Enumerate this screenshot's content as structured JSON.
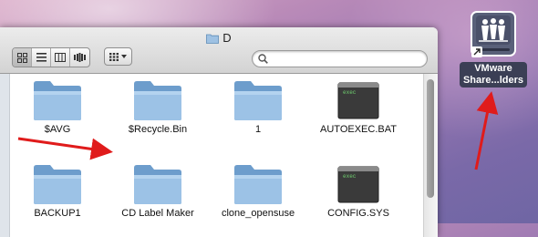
{
  "window": {
    "title": "D",
    "search": {
      "value": "",
      "placeholder": ""
    }
  },
  "toolbar": {
    "view_buttons": [
      "icon-view-icon",
      "list-view-icon",
      "column-view-icon",
      "cover-flow-icon"
    ],
    "active_view": "icon"
  },
  "files": [
    {
      "name": "$AVG",
      "kind": "folder"
    },
    {
      "name": "$Recycle.Bin",
      "kind": "folder"
    },
    {
      "name": "1",
      "kind": "folder"
    },
    {
      "name": "AUTOEXEC.BAT",
      "kind": "exec"
    },
    {
      "name": "BACKUP1",
      "kind": "folder"
    },
    {
      "name": "CD Label Maker",
      "kind": "folder"
    },
    {
      "name": "clone_opensuse",
      "kind": "folder"
    },
    {
      "name": "CONFIG.SYS",
      "kind": "exec"
    }
  ],
  "exec_icon_text": "exec",
  "desktop": {
    "drive_label_line1": "VMware",
    "drive_label_line2": "Share...lders"
  },
  "colors": {
    "annotation_arrow": "#e01b1b",
    "folder_blue": "#8fb6dc",
    "desktop_purple": "#9a78b2"
  }
}
